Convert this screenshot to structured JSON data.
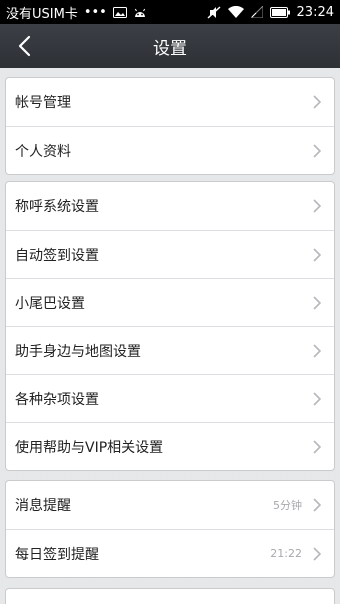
{
  "status_bar": {
    "carrier": "没有USIM卡",
    "dots": "•••",
    "time": "23:24"
  },
  "header": {
    "title": "设置"
  },
  "groups": [
    {
      "items": [
        {
          "label": "帐号管理"
        },
        {
          "label": "个人资料"
        }
      ]
    },
    {
      "items": [
        {
          "label": "称呼系统设置"
        },
        {
          "label": "自动签到设置"
        },
        {
          "label": "小尾巴设置"
        },
        {
          "label": "助手身边与地图设置"
        },
        {
          "label": "各种杂项设置"
        },
        {
          "label": "使用帮助与VIP相关设置"
        }
      ]
    },
    {
      "items": [
        {
          "label": "消息提醒",
          "value": "5分钟"
        },
        {
          "label": "每日签到提醒",
          "value": "21:22"
        }
      ]
    }
  ],
  "colors": {
    "header_bg": "#2d3035",
    "page_bg": "#e6e7e9",
    "chevron": "#b5b7ba"
  }
}
